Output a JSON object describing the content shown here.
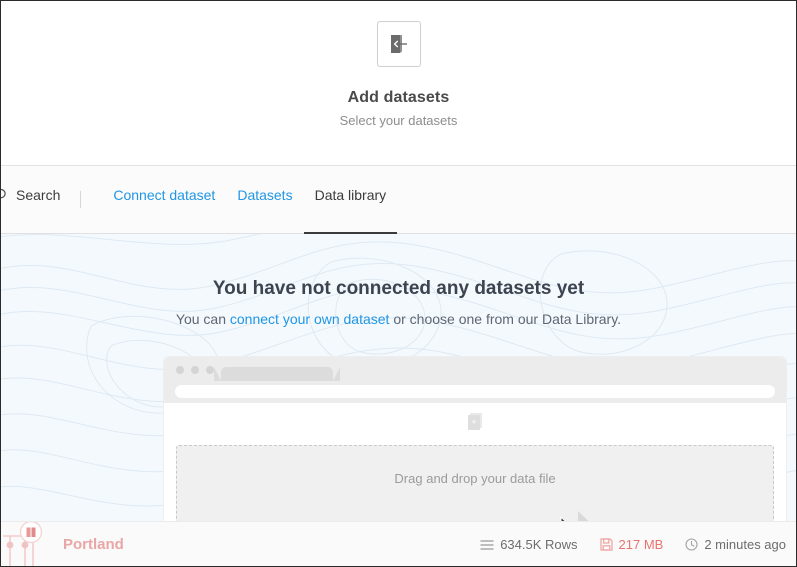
{
  "header": {
    "icon": "import-dataset-icon",
    "title": "Add datasets",
    "subtitle": "Select your datasets"
  },
  "tabbar": {
    "search": {
      "icon": "search-icon",
      "label": "Search"
    },
    "tabs": [
      {
        "label": "Connect dataset",
        "active": false
      },
      {
        "label": "Datasets",
        "active": false
      },
      {
        "label": "Data library",
        "active": true
      }
    ]
  },
  "main": {
    "empty_title": "You have not connected any datasets yet",
    "empty_sub_before": "You can ",
    "empty_sub_link": "connect your own dataset",
    "empty_sub_after": " or choose one from our Data Library.",
    "illustration": {
      "dropzone_label": "Drag and drop your data file",
      "doc_icon": "new-document-icon",
      "cursor_icon": "drag-copy-cursor-icon"
    }
  },
  "footer": {
    "project": {
      "icon": "data-library-book-icon",
      "name": "Portland"
    },
    "stats": [
      {
        "icon": "rows-list-icon",
        "label": "634.5K Rows",
        "kind": "rows"
      },
      {
        "icon": "save-disk-icon",
        "label": "217 MB",
        "kind": "size"
      },
      {
        "icon": "clock-icon",
        "label": "2 minutes ago",
        "kind": "time"
      }
    ]
  },
  "colors": {
    "accent_blue": "#2196e3",
    "footer_pink": "#e9a6a6",
    "size_red": "#e8736f",
    "body_bg": "#f4f9fd",
    "badge_green": "#5cb828"
  }
}
